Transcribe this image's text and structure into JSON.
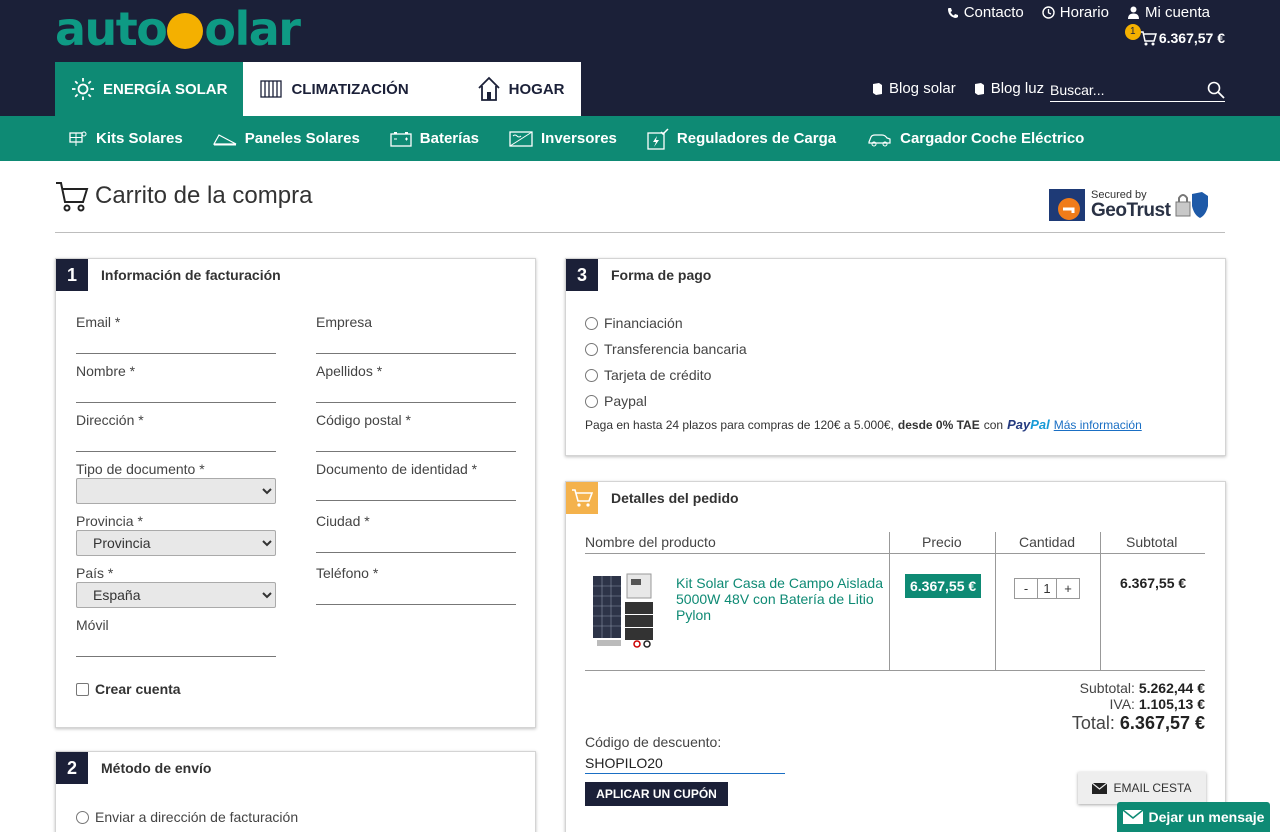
{
  "brand": {
    "logo_part1": "auto",
    "logo_part2": "olar"
  },
  "header": {
    "contact": "Contacto",
    "schedule": "Horario",
    "account": "Mi cuenta",
    "cart_count": "1",
    "cart_total": "6.367,57 €",
    "tabs": [
      "ENERGÍA SOLAR",
      "CLIMATIZACIÓN",
      "HOGAR"
    ],
    "blog_solar": "Blog solar",
    "blog_luz": "Blog luz",
    "search_placeholder": "Buscar..."
  },
  "categories": [
    "Kits Solares",
    "Paneles Solares",
    "Baterías",
    "Inversores",
    "Reguladores de Carga",
    "Cargador Coche Eléctrico"
  ],
  "page": {
    "title": "Carrito de la compra",
    "secured_by": "Secured by",
    "geotrust": "GeoTrust"
  },
  "billing": {
    "number": "1",
    "title": "Información de facturación",
    "email": "Email *",
    "empresa": "Empresa",
    "nombre": "Nombre *",
    "apellidos": "Apellidos *",
    "direccion": "Dirección *",
    "codigo_postal": "Código postal *",
    "tipo_documento": "Tipo de documento *",
    "documento_identidad": "Documento de identidad *",
    "provincia": "Provincia *",
    "provincia_value": "Provincia",
    "ciudad": "Ciudad *",
    "pais": "País *",
    "pais_value": "España",
    "telefono": "Teléfono *",
    "movil": "Móvil",
    "crear_cuenta": "Crear cuenta"
  },
  "shipping": {
    "number": "2",
    "title": "Método de envío",
    "option1": "Enviar a dirección de facturación"
  },
  "payment": {
    "number": "3",
    "title": "Forma de pago",
    "options": [
      "Financiación",
      "Transferencia bancaria",
      "Tarjeta de crédito",
      "Paypal"
    ],
    "note_part1": "Paga en hasta 24 plazos para compras de 120€ a 5.000€,",
    "note_bold": "desde 0% TAE",
    "note_con": "con",
    "paypal_pay": "Pay",
    "paypal_pal": "Pal",
    "more_info": "Más información"
  },
  "order": {
    "title": "Detalles del pedido",
    "col_product": "Nombre del producto",
    "col_price": "Precio",
    "col_qty": "Cantidad",
    "col_subtotal": "Subtotal",
    "product_name": "Kit Solar Casa de Campo Aislada 5000W 48V con Batería de Litio Pylon",
    "price": "6.367,55 €",
    "qty_minus": "-",
    "qty": "1",
    "qty_plus": "+",
    "line_subtotal": "6.367,55 €",
    "subtotal_label": "Subtotal:",
    "subtotal_value": "5.262,44 €",
    "iva_label": "IVA:",
    "iva_value": "1.105,13 €",
    "total_label": "Total:",
    "total_value": "6.367,57 €",
    "coupon_label": "Código de descuento:",
    "coupon_value": "SHOPILO20",
    "apply_coupon": "APLICAR UN CUPÓN",
    "email_cart": "EMAIL CESTA"
  },
  "chat": {
    "label": "Dejar un mensaje"
  },
  "colors": {
    "navy": "#1b2038",
    "teal": "#0e8a74",
    "yellow": "#f4b000",
    "orange": "#f4b24c"
  }
}
